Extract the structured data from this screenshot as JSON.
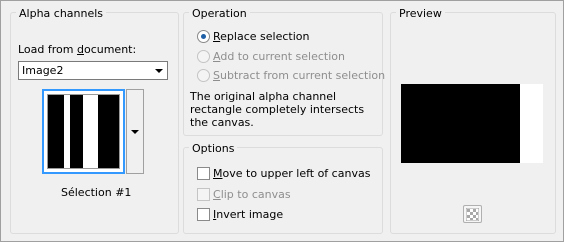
{
  "alpha": {
    "title": "Alpha channels",
    "load_label_pre": "Load from ",
    "load_label_u": "d",
    "load_label_post": "ocument:",
    "document_value": "Image2",
    "selection_name": "Sélection #1",
    "thumb_stripes": [
      "black",
      "white",
      "black",
      "white",
      "black"
    ]
  },
  "operation": {
    "title": "Operation",
    "options": [
      {
        "u": "R",
        "rest": "eplace selection",
        "selected": true,
        "disabled": false
      },
      {
        "u": "A",
        "rest": "dd to current selection",
        "selected": false,
        "disabled": true
      },
      {
        "u": "S",
        "rest": "ubtract from current selection",
        "selected": false,
        "disabled": true
      }
    ],
    "description": "The original alpha channel rectangle completely intersects the canvas."
  },
  "options": {
    "title": "Options",
    "items": [
      {
        "u": "M",
        "rest": "ove to upper left of canvas",
        "checked": false,
        "disabled": false
      },
      {
        "u": "C",
        "rest": "lip to canvas",
        "checked": false,
        "disabled": true
      },
      {
        "u": "I",
        "rest": "nvert image",
        "checked": false,
        "disabled": false
      }
    ]
  },
  "preview": {
    "title": "Preview",
    "toggle_icon": "checkerboard-icon"
  },
  "colors": {
    "accent": "#3399ff",
    "radio_dot": "#1e5fa6",
    "group_border": "#dcdcdc"
  }
}
